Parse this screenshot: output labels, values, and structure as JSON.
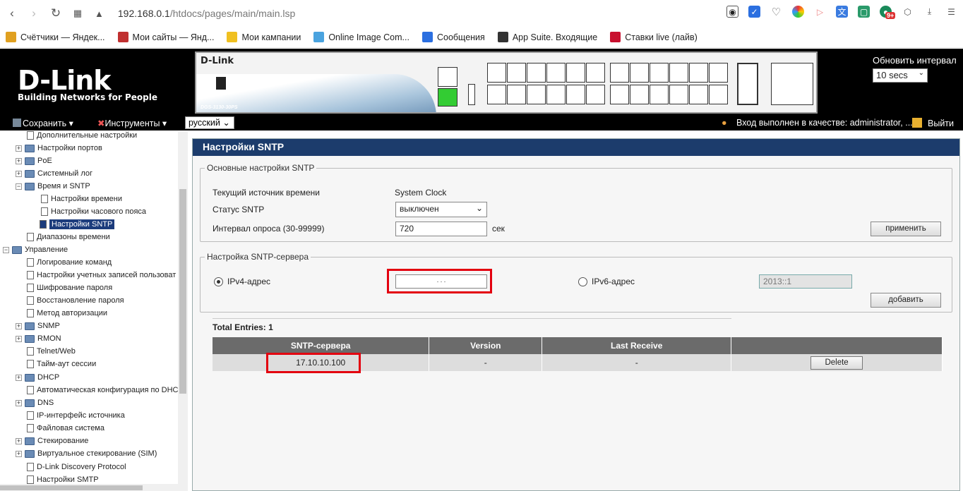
{
  "browser": {
    "url_host": "192.168.0.1",
    "url_path": "/htdocs/pages/main/main.lsp",
    "bookmarks": [
      {
        "label": "Счётчики — Яндек...",
        "color": "#e0a020"
      },
      {
        "label": "Мои сайты — Янд...",
        "color": "#c03030"
      },
      {
        "label": "Мои кампании",
        "color": "#f0c020"
      },
      {
        "label": "Online Image Com...",
        "color": "#4aa3df"
      },
      {
        "label": "Сообщения",
        "color": "#2b6fe0"
      },
      {
        "label": "App Suite. Входящие",
        "color": "#333333"
      },
      {
        "label": "Ставки live (лайв)",
        "color": "#c8102e"
      }
    ],
    "badge": "9+"
  },
  "header": {
    "logo_text": "D-Link",
    "logo_tagline": "Building Networks for People",
    "panel_brand": "D-Link",
    "panel_model": "DGS-3130-30PS",
    "refresh_label": "Обновить интервал",
    "refresh_value": "10 secs"
  },
  "toolbar": {
    "save": "Сохранить",
    "tools": "Инструменты",
    "language": "русский",
    "login_status": "Вход выполнен в качестве: administrator, ...",
    "logout": "Выйти"
  },
  "sidebar": {
    "items": [
      {
        "label": "Дополнительные настройки",
        "kind": "doc"
      },
      {
        "label": "Настройки портов",
        "kind": "folder"
      },
      {
        "label": "PoE",
        "kind": "folder"
      },
      {
        "label": "Системный лог",
        "kind": "folder"
      },
      {
        "label": "Время и SNTP",
        "kind": "folder"
      },
      {
        "label": "Настройки времени",
        "kind": "doc"
      },
      {
        "label": "Настройки часового пояса",
        "kind": "doc"
      },
      {
        "label": "Настройки SNTP",
        "kind": "doc"
      },
      {
        "label": "Диапазоны времени",
        "kind": "doc"
      },
      {
        "label": "Управление",
        "kind": "folder"
      },
      {
        "label": "Логирование команд",
        "kind": "doc"
      },
      {
        "label": "Настройки учетных записей пользоват",
        "kind": "doc"
      },
      {
        "label": "Шифрование пароля",
        "kind": "doc"
      },
      {
        "label": "Восстановление пароля",
        "kind": "doc"
      },
      {
        "label": "Метод авторизации",
        "kind": "doc"
      },
      {
        "label": "SNMP",
        "kind": "folder"
      },
      {
        "label": "RMON",
        "kind": "folder"
      },
      {
        "label": "Telnet/Web",
        "kind": "doc"
      },
      {
        "label": "Тайм-аут сессии",
        "kind": "doc"
      },
      {
        "label": "DHCP",
        "kind": "folder"
      },
      {
        "label": "Автоматическая конфигурация по DHC",
        "kind": "doc"
      },
      {
        "label": "DNS",
        "kind": "folder"
      },
      {
        "label": "IP-интерфейс источника",
        "kind": "doc"
      },
      {
        "label": "Файловая система",
        "kind": "doc"
      },
      {
        "label": "Стекирование",
        "kind": "folder"
      },
      {
        "label": "Виртуальное стекирование (SIM)",
        "kind": "folder"
      },
      {
        "label": "D-Link Discovery Protocol",
        "kind": "doc"
      },
      {
        "label": "Настройки SMTP",
        "kind": "doc"
      }
    ]
  },
  "content": {
    "title": "Настройки SNTP",
    "basic": {
      "legend": "Основные настройки SNTP",
      "source_label": "Текущий источник времени",
      "source_value": "System Clock",
      "status_label": "Статус SNTP",
      "status_value": "выключен",
      "interval_label": "Интервал опроса (30-99999)",
      "interval_value": "720",
      "interval_unit": "сек",
      "apply_button": "применить"
    },
    "server": {
      "legend": "Настройка SNTP-сервера",
      "ipv4_label": "IPv4-адрес",
      "ipv4_value": ".      .      .",
      "ipv6_label": "IPv6-адрес",
      "ipv6_value": "2013::1",
      "add_button": "добавить"
    },
    "table": {
      "total": "Total Entries: 1",
      "headers": [
        "SNTP-сервера",
        "Version",
        "Last Receive",
        ""
      ],
      "rows": [
        {
          "server": "17.10.10.100",
          "version": "-",
          "last_receive": "-",
          "action": "Delete"
        }
      ]
    }
  }
}
